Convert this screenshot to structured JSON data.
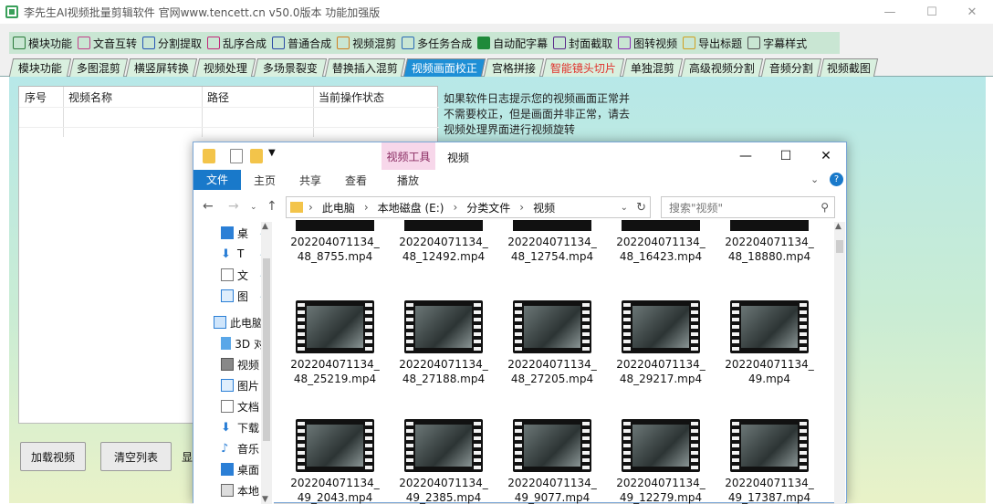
{
  "window": {
    "title": "李先生AI视频批量剪辑软件    官网www.tencett.cn    v50.0版本   功能加强版"
  },
  "toolbar": {
    "items": [
      {
        "label": "模块功能",
        "icon": "grid-icon"
      },
      {
        "label": "文音互转",
        "icon": "text-audio-icon"
      },
      {
        "label": "分割提取",
        "icon": "split-icon"
      },
      {
        "label": "乱序合成",
        "icon": "shuffle-icon"
      },
      {
        "label": "普通合成",
        "icon": "layers-icon"
      },
      {
        "label": "视频混剪",
        "icon": "video-icon"
      },
      {
        "label": "多任务合成",
        "icon": "tasks-icon"
      },
      {
        "label": "自动配字幕",
        "icon": "chart-icon"
      },
      {
        "label": "封面截取",
        "icon": "cover-icon"
      },
      {
        "label": "图转视频",
        "icon": "image-video-icon"
      },
      {
        "label": "导出标题",
        "icon": "export-icon"
      },
      {
        "label": "字幕样式",
        "icon": "text-style-icon"
      }
    ]
  },
  "tabs": [
    {
      "label": "模块功能"
    },
    {
      "label": "多图混剪"
    },
    {
      "label": "横竖屏转换"
    },
    {
      "label": "视频处理"
    },
    {
      "label": "多场景裂变"
    },
    {
      "label": "替换插入混剪"
    },
    {
      "label": "视频画面校正"
    },
    {
      "label": "宫格拼接"
    },
    {
      "label": "智能镜头切片"
    },
    {
      "label": "单独混剪"
    },
    {
      "label": "高级视频分割"
    },
    {
      "label": "音频分割"
    },
    {
      "label": "视频截图"
    }
  ],
  "table": {
    "columns": [
      "序号",
      "视频名称",
      "路径",
      "当前操作状态"
    ]
  },
  "hint": {
    "lines": [
      "如果软件日志提示您的视频画面正常并",
      "不需要校正，但是画面并非正常，请去",
      "视频处理界面进行视频旋转"
    ]
  },
  "buttons": {
    "load": "加载视频",
    "clear": "清空列表",
    "partial": "显"
  },
  "explorer": {
    "context_tab": "视频工具",
    "folder_name": "视频",
    "ribbon_tabs": [
      "文件",
      "主页",
      "共享",
      "查看",
      "播放"
    ],
    "path": [
      "此电脑",
      "本地磁盘 (E:)",
      "分类文件",
      "视频"
    ],
    "search_placeholder": "搜索\"视频\"",
    "nav_items": [
      {
        "label": "桌",
        "icon": "desktop-icon"
      },
      {
        "label": "T",
        "icon": "download-icon"
      },
      {
        "label": "文",
        "icon": "document-icon"
      },
      {
        "label": "图",
        "icon": "picture-icon"
      },
      {
        "label": "此电脑",
        "icon": "computer-icon"
      },
      {
        "label": "3D 对",
        "icon": "cube-icon"
      },
      {
        "label": "视频",
        "icon": "video-folder-icon"
      },
      {
        "label": "图片",
        "icon": "picture-folder-icon"
      },
      {
        "label": "文档",
        "icon": "document-folder-icon"
      },
      {
        "label": "下载",
        "icon": "download-folder-icon"
      },
      {
        "label": "音乐",
        "icon": "music-icon"
      },
      {
        "label": "桌面",
        "icon": "desktop-folder-icon"
      },
      {
        "label": "本地",
        "icon": "drive-icon"
      }
    ],
    "files": [
      {
        "line1": "202204071134_",
        "line2": "48_8755.mp4"
      },
      {
        "line1": "202204071134_",
        "line2": "48_12492.mp4"
      },
      {
        "line1": "202204071134_",
        "line2": "48_12754.mp4"
      },
      {
        "line1": "202204071134_",
        "line2": "48_16423.mp4"
      },
      {
        "line1": "202204071134_",
        "line2": "48_18880.mp4"
      },
      {
        "line1": "202204071134_",
        "line2": "48_25219.mp4"
      },
      {
        "line1": "202204071134_",
        "line2": "48_27188.mp4"
      },
      {
        "line1": "202204071134_",
        "line2": "48_27205.mp4"
      },
      {
        "line1": "202204071134_",
        "line2": "48_29217.mp4"
      },
      {
        "line1": "202204071134_",
        "line2": "49.mp4"
      },
      {
        "line1": "202204071134_",
        "line2": "49_2043.mp4"
      },
      {
        "line1": "202204071134_",
        "line2": "49_2385.mp4"
      },
      {
        "line1": "202204071134_",
        "line2": "49_9077.mp4"
      },
      {
        "line1": "202204071134_",
        "line2": "49_12279.mp4"
      },
      {
        "line1": "202204071134_",
        "line2": "49_17387.mp4"
      }
    ]
  }
}
